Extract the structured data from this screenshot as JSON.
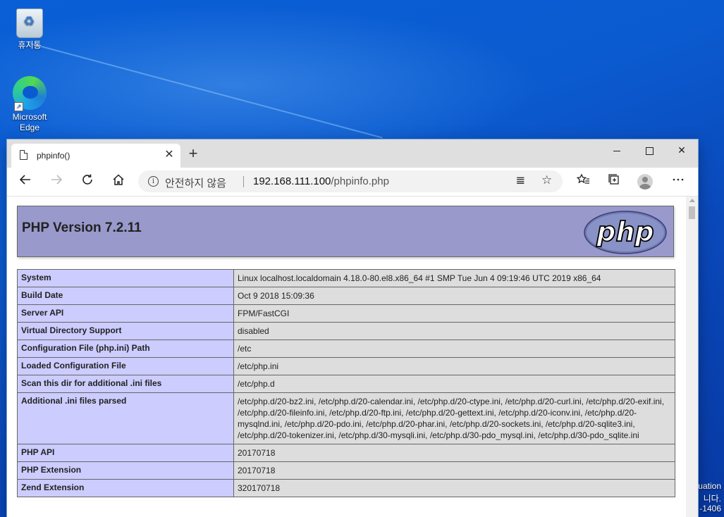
{
  "desktop": {
    "icons": [
      {
        "label": "휴지통"
      },
      {
        "label": "Microsoft Edge"
      }
    ],
    "side_text": [
      "uation",
      "니다.",
      "-1406"
    ]
  },
  "browser": {
    "tab": {
      "title": "phpinfo()"
    },
    "address": {
      "security_label": "안전하지 않음",
      "host": "192.168.111.100",
      "path": "/phpinfo.php"
    }
  },
  "page": {
    "heading": "PHP Version 7.2.11",
    "logo_text": "php",
    "rows": [
      {
        "label": "System",
        "value": "Linux localhost.localdomain 4.18.0-80.el8.x86_64 #1 SMP Tue Jun 4 09:19:46 UTC 2019 x86_64"
      },
      {
        "label": "Build Date",
        "value": "Oct 9 2018 15:09:36"
      },
      {
        "label": "Server API",
        "value": "FPM/FastCGI"
      },
      {
        "label": "Virtual Directory Support",
        "value": "disabled"
      },
      {
        "label": "Configuration File (php.ini) Path",
        "value": "/etc"
      },
      {
        "label": "Loaded Configuration File",
        "value": "/etc/php.ini"
      },
      {
        "label": "Scan this dir for additional .ini files",
        "value": "/etc/php.d"
      },
      {
        "label": "Additional .ini files parsed",
        "value": "/etc/php.d/20-bz2.ini, /etc/php.d/20-calendar.ini, /etc/php.d/20-ctype.ini, /etc/php.d/20-curl.ini, /etc/php.d/20-exif.ini, /etc/php.d/20-fileinfo.ini, /etc/php.d/20-ftp.ini, /etc/php.d/20-gettext.ini, /etc/php.d/20-iconv.ini, /etc/php.d/20-mysqlnd.ini, /etc/php.d/20-pdo.ini, /etc/php.d/20-phar.ini, /etc/php.d/20-sockets.ini, /etc/php.d/20-sqlite3.ini, /etc/php.d/20-tokenizer.ini, /etc/php.d/30-mysqli.ini, /etc/php.d/30-pdo_mysql.ini, /etc/php.d/30-pdo_sqlite.ini"
      },
      {
        "label": "PHP API",
        "value": "20170718"
      },
      {
        "label": "PHP Extension",
        "value": "20170718"
      },
      {
        "label": "Zend Extension",
        "value": "320170718"
      }
    ]
  }
}
